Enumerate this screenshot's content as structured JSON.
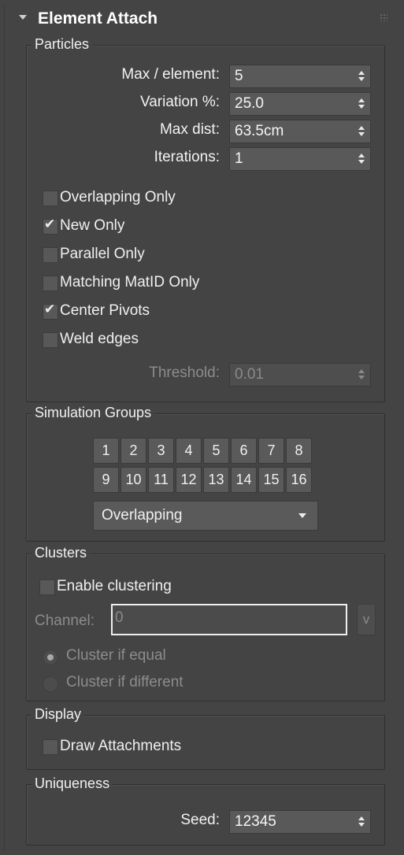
{
  "rollout": {
    "title": "Element Attach"
  },
  "particles": {
    "title": "Particles",
    "max_per_element": {
      "label": "Max / element:",
      "value": "5"
    },
    "variation": {
      "label": "Variation %:",
      "value": "25.0"
    },
    "max_dist": {
      "label": "Max dist:",
      "value": "63.5cm"
    },
    "iterations": {
      "label": "Iterations:",
      "value": "1"
    },
    "checkboxes": [
      {
        "label": "Overlapping Only",
        "checked": false
      },
      {
        "label": "New Only",
        "checked": true
      },
      {
        "label": "Parallel Only",
        "checked": false
      },
      {
        "label": "Matching MatID Only",
        "checked": false
      },
      {
        "label": "Center Pivots",
        "checked": true
      },
      {
        "label": "Weld edges",
        "checked": false
      }
    ],
    "threshold": {
      "label": "Threshold:",
      "value": "0.01"
    }
  },
  "simulation_groups": {
    "title": "Simulation Groups",
    "buttons": [
      "1",
      "2",
      "3",
      "4",
      "5",
      "6",
      "7",
      "8",
      "9",
      "10",
      "11",
      "12",
      "13",
      "14",
      "15",
      "16"
    ],
    "mode": "Overlapping"
  },
  "clusters": {
    "title": "Clusters",
    "enable_label": "Enable clustering",
    "channel_label": "Channel:",
    "channel_value": "0",
    "v_button": "v",
    "radio_equal": "Cluster if equal",
    "radio_different": "Cluster if different"
  },
  "display": {
    "title": "Display",
    "draw_attachments": "Draw Attachments"
  },
  "uniqueness": {
    "title": "Uniqueness",
    "seed_label": "Seed:",
    "seed_value": "12345"
  },
  "colors": {
    "background": "#444444",
    "field": "#595959",
    "text": "#f0f0f0",
    "disabled_text": "#8a8a8a"
  }
}
